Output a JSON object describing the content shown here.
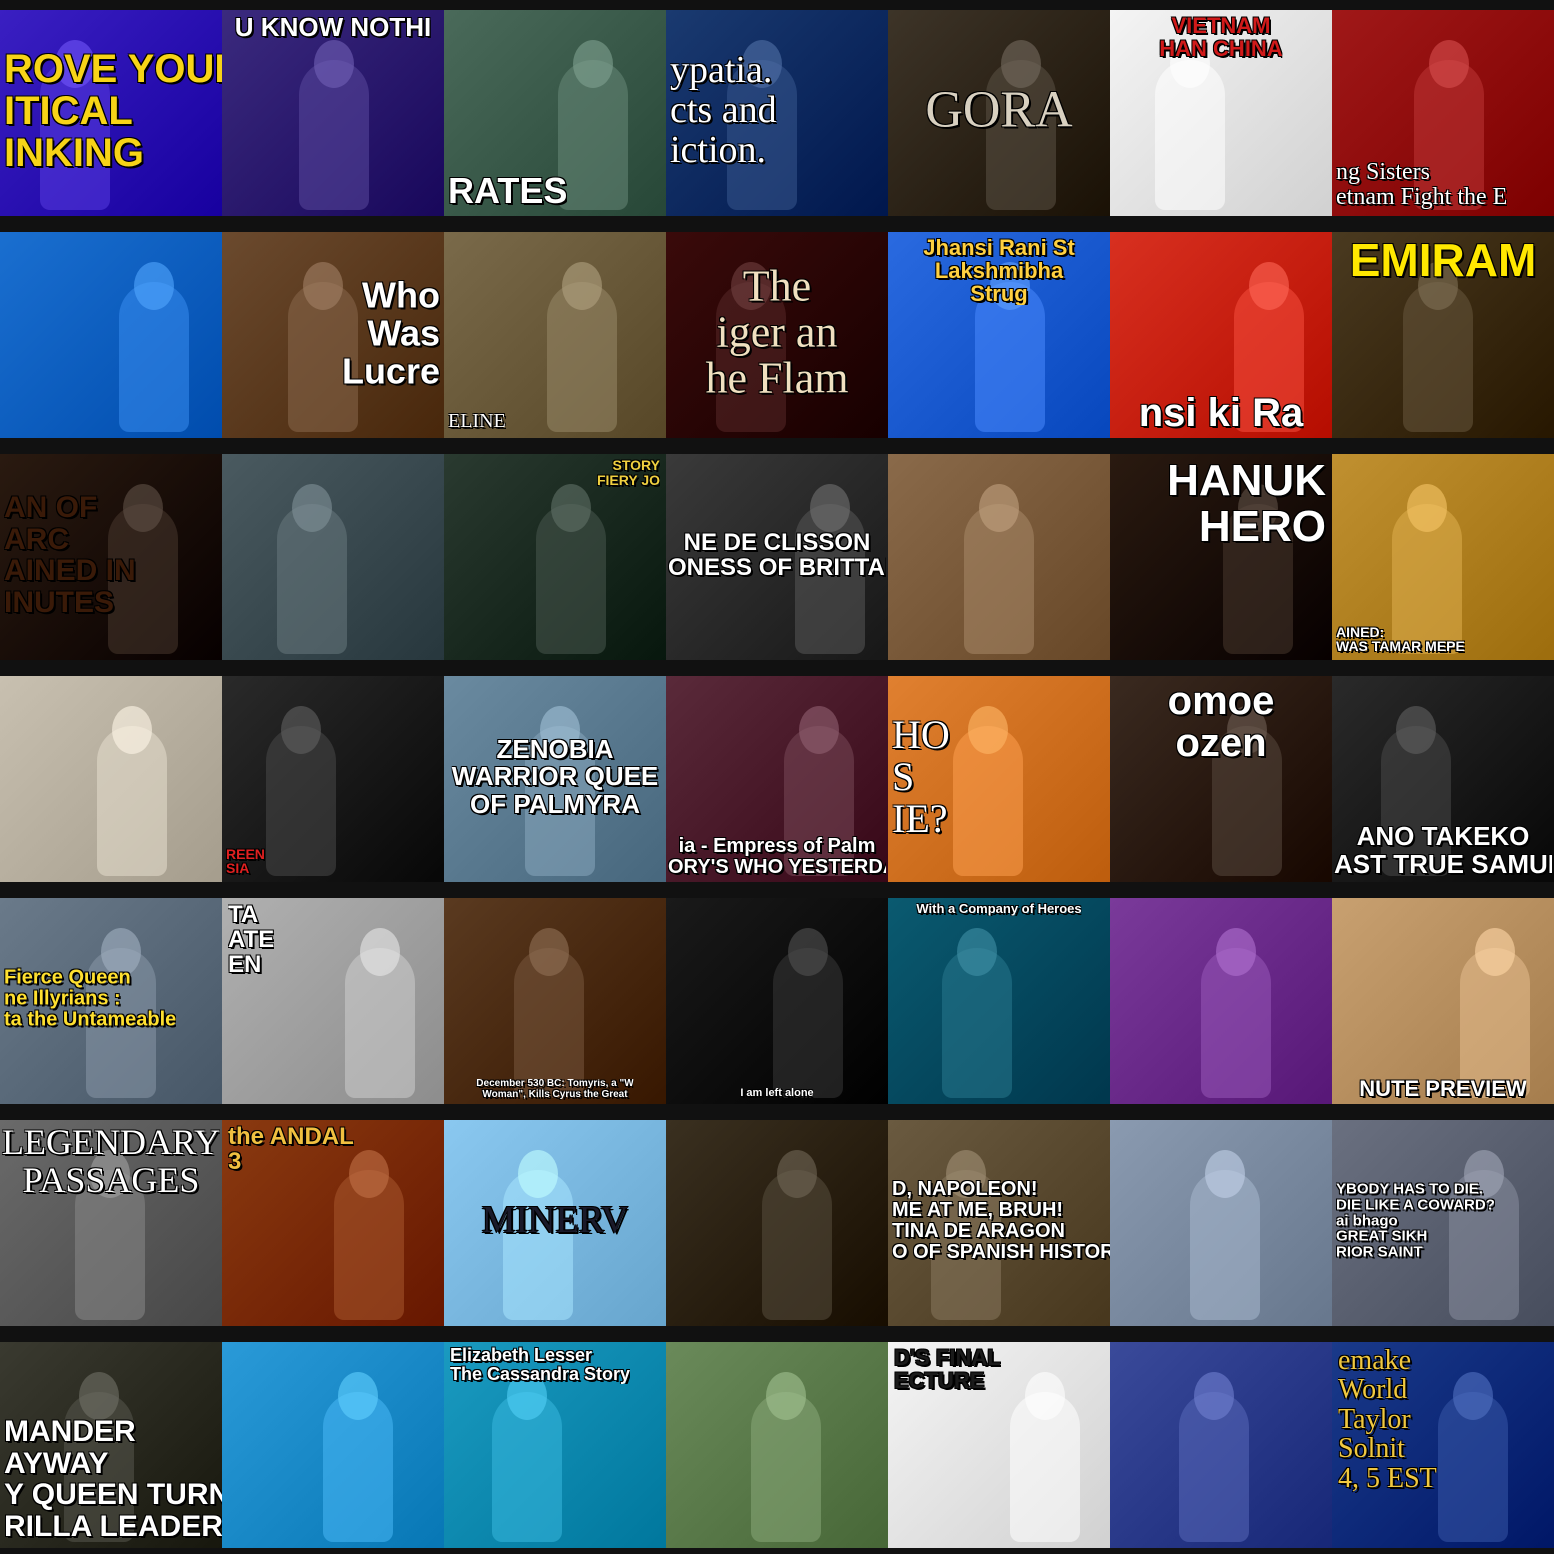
{
  "tiles": [
    {
      "text": "ROVE YOUR\nITICAL\nINKING",
      "bg": "#3a1fc2",
      "fg": "#f7d417",
      "font": "sans",
      "size": 40,
      "pos": "l"
    },
    {
      "text": "U KNOW NOTHI",
      "bg": "#3b2a7e",
      "fg": "#ffffff",
      "font": "sans",
      "size": 26,
      "pos": "t"
    },
    {
      "text": "RATES",
      "bg": "#4a6a5a",
      "fg": "#ffffff",
      "font": "sans",
      "size": 36,
      "pos": "bl"
    },
    {
      "text": "ypatia.\ncts and\niction.",
      "bg": "#1a3a70",
      "fg": "#ffffff",
      "font": "serif",
      "size": 38,
      "pos": "l"
    },
    {
      "text": "GORA",
      "bg": "#3d3428",
      "fg": "#d8d0c0",
      "font": "serif",
      "size": 52,
      "pos": "c"
    },
    {
      "text": "VIETNAM\nHAN CHINA",
      "bg": "#f4f4f4",
      "fg": "#d01a1a",
      "font": "sans",
      "size": 22,
      "pos": "t"
    },
    {
      "text": "ng Sisters\netnam Fight the E",
      "bg": "#a01818",
      "fg": "#ffffff",
      "font": "serif",
      "size": 24,
      "pos": "bl"
    },
    {
      "text": "",
      "bg": "#1a6fd0",
      "fg": "#ffffff",
      "font": "sans",
      "size": 14,
      "pos": "c"
    },
    {
      "text": "Who\nWas\nLucre",
      "bg": "#6b4a2e",
      "fg": "#ffffff",
      "font": "sans",
      "size": 36,
      "pos": "r"
    },
    {
      "text": "ELINE",
      "bg": "#7a6a4a",
      "fg": "#ffffff",
      "font": "serif",
      "size": 20,
      "pos": "bl"
    },
    {
      "text": "The\niger an\nhe Flam",
      "bg": "#3a0a0a",
      "fg": "#f0e0c0",
      "font": "serif",
      "size": 44,
      "pos": "c"
    },
    {
      "text": "Jhansi Rani St\nLakshmibha\nStrug",
      "bg": "#2a6ae0",
      "fg": "#ffd040",
      "font": "sans",
      "size": 22,
      "pos": "t"
    },
    {
      "text": "nsi ki Ra",
      "bg": "#d83020",
      "fg": "#ffffff",
      "font": "sans",
      "size": 40,
      "pos": "b"
    },
    {
      "text": "EMIRAM",
      "bg": "#4a3a20",
      "fg": "#ffe800",
      "font": "sans",
      "size": 46,
      "pos": "t"
    },
    {
      "text": "AN OF\nARC\nAINED IN\nINUTES",
      "bg": "#2a1a10",
      "fg": "#3a1a08",
      "font": "sans",
      "size": 30,
      "pos": "l"
    },
    {
      "text": "",
      "bg": "#4a5a60",
      "fg": "#ffffff",
      "font": "sans",
      "size": 14,
      "pos": "c"
    },
    {
      "text": "STORY\nFIERY JO",
      "bg": "#2a3a30",
      "fg": "#f0d040",
      "font": "sans",
      "size": 14,
      "pos": "tr"
    },
    {
      "text": "NE DE CLISSON\nONESS OF BRITTANY",
      "bg": "#3a3a3a",
      "fg": "#ffffff",
      "font": "sans",
      "size": 24,
      "pos": "c"
    },
    {
      "text": "",
      "bg": "#8a6a4a",
      "fg": "#ffffff",
      "font": "sans",
      "size": 14,
      "pos": "c"
    },
    {
      "text": "HANUK\nHERO",
      "bg": "#2a1a10",
      "fg": "#ffffff",
      "font": "sans",
      "size": 44,
      "pos": "tr"
    },
    {
      "text": "AINED:\nWAS TAMAR MEPE",
      "bg": "#c09030",
      "fg": "#ffffff",
      "font": "sans",
      "size": 14,
      "pos": "bl"
    },
    {
      "text": "",
      "bg": "#c8c0b0",
      "fg": "#ffffff",
      "font": "sans",
      "size": 14,
      "pos": "c"
    },
    {
      "text": "REEN\nSIA",
      "bg": "#2a2a2a",
      "fg": "#e02020",
      "font": "sans",
      "size": 14,
      "pos": "bl"
    },
    {
      "text": "ZENOBIA\nWARRIOR QUEE\nOF PALMYRA",
      "bg": "#6a8aa0",
      "fg": "#ffffff",
      "font": "sans",
      "size": 26,
      "pos": "c"
    },
    {
      "text": "ia - Empress of Palm\nORY'S WHO YESTERDAY'S NATION",
      "bg": "#5a2a3a",
      "fg": "#ffffff",
      "font": "sans",
      "size": 20,
      "pos": "b"
    },
    {
      "text": "HO\nS\nIE?",
      "bg": "#e08030",
      "fg": "#ffffff",
      "font": "serif",
      "size": 40,
      "pos": "l"
    },
    {
      "text": "omoe\nozen",
      "bg": "#3a2a20",
      "fg": "#ffffff",
      "font": "sans",
      "size": 40,
      "pos": "t"
    },
    {
      "text": "ANO TAKEKO\nAST TRUE SAMURAI",
      "bg": "#2a2a2a",
      "fg": "#ffffff",
      "font": "sans",
      "size": 26,
      "pos": "b"
    },
    {
      "text": "Fierce Queen\nne Illyrians :\nta the Untameable",
      "bg": "#6a7a8a",
      "fg": "#ffe030",
      "font": "sans",
      "size": 20,
      "pos": "l"
    },
    {
      "text": "TA\nATE\nEN",
      "bg": "#b0b0b0",
      "fg": "#ffffff",
      "font": "sans",
      "size": 24,
      "pos": "tl"
    },
    {
      "text": "December 530 BC: Tomyris, a \"W\nWoman\", Kills Cyrus the Great",
      "bg": "#5a3a20",
      "fg": "#ffffff",
      "font": "sans",
      "size": 10,
      "pos": "b"
    },
    {
      "text": "I am left alone",
      "bg": "#1a1a1a",
      "fg": "#ffffff",
      "font": "sans",
      "size": 11,
      "pos": "b"
    },
    {
      "text": "With a Company of Heroes",
      "bg": "#0a5a70",
      "fg": "#ffffff",
      "font": "sans",
      "size": 13,
      "pos": "t"
    },
    {
      "text": "",
      "bg": "#7a3a9a",
      "fg": "#ffffff",
      "font": "sans",
      "size": 14,
      "pos": "c"
    },
    {
      "text": "NUTE PREVIEW",
      "bg": "#c8a070",
      "fg": "#ffffff",
      "font": "sans",
      "size": 22,
      "pos": "b"
    },
    {
      "text": "LEGENDARY\nPASSAGES",
      "bg": "#6a6a6a",
      "fg": "#ffffff",
      "font": "serif",
      "size": 36,
      "pos": "t"
    },
    {
      "text": "the ANDAL\n3",
      "bg": "#8a3a10",
      "fg": "#f0c040",
      "font": "sans",
      "size": 24,
      "pos": "tl"
    },
    {
      "text": "MINERV",
      "bg": "#8ac8f0",
      "fg": "#1a1a2a",
      "font": "serif",
      "size": 38,
      "pos": "c"
    },
    {
      "text": "",
      "bg": "#3a3020",
      "fg": "#ffffff",
      "font": "sans",
      "size": 14,
      "pos": "c"
    },
    {
      "text": "D, NAPOLEON!\nME AT ME, BRUH!\nTINA DE ARAGON\nO OF SPANISH HISTORY",
      "bg": "#6a5a40",
      "fg": "#ffffff",
      "font": "sans",
      "size": 20,
      "pos": "l"
    },
    {
      "text": "",
      "bg": "#8a9ab0",
      "fg": "#ffffff",
      "font": "sans",
      "size": 14,
      "pos": "c"
    },
    {
      "text": "YBODY HAS TO DIE.\nDIE LIKE A COWARD?\nai bhago\nGREAT SIKH\nRIOR SAINT",
      "bg": "#6a7080",
      "fg": "#ffffff",
      "font": "sans",
      "size": 15,
      "pos": "l"
    },
    {
      "text": "MANDER\nAYWAY\nY QUEEN TURNED\nRILLA LEADER",
      "bg": "#3a3a30",
      "fg": "#ffffff",
      "font": "sans",
      "size": 30,
      "pos": "bl"
    },
    {
      "text": "",
      "bg": "#2a9ad8",
      "fg": "#ffffff",
      "font": "sans",
      "size": 14,
      "pos": "c"
    },
    {
      "text": "Elizabeth Lesser\nThe Cassandra Story",
      "bg": "#1a9ac0",
      "fg": "#ffffff",
      "font": "sans",
      "size": 18,
      "pos": "tl"
    },
    {
      "text": "",
      "bg": "#6a8a5a",
      "fg": "#ffffff",
      "font": "sans",
      "size": 14,
      "pos": "c"
    },
    {
      "text": "D'S FINAL\nECTURE",
      "bg": "#f4f4f4",
      "fg": "#1a1a1a",
      "font": "sans",
      "size": 22,
      "pos": "tl"
    },
    {
      "text": "",
      "bg": "#3a4a9a",
      "fg": "#ffffff",
      "font": "sans",
      "size": 14,
      "pos": "c"
    },
    {
      "text": "emake\nWorld\nTaylor\nSolnit\n4, 5 EST",
      "bg": "#1a3a8a",
      "fg": "#f0c840",
      "font": "serif",
      "size": 28,
      "pos": "tl"
    }
  ]
}
